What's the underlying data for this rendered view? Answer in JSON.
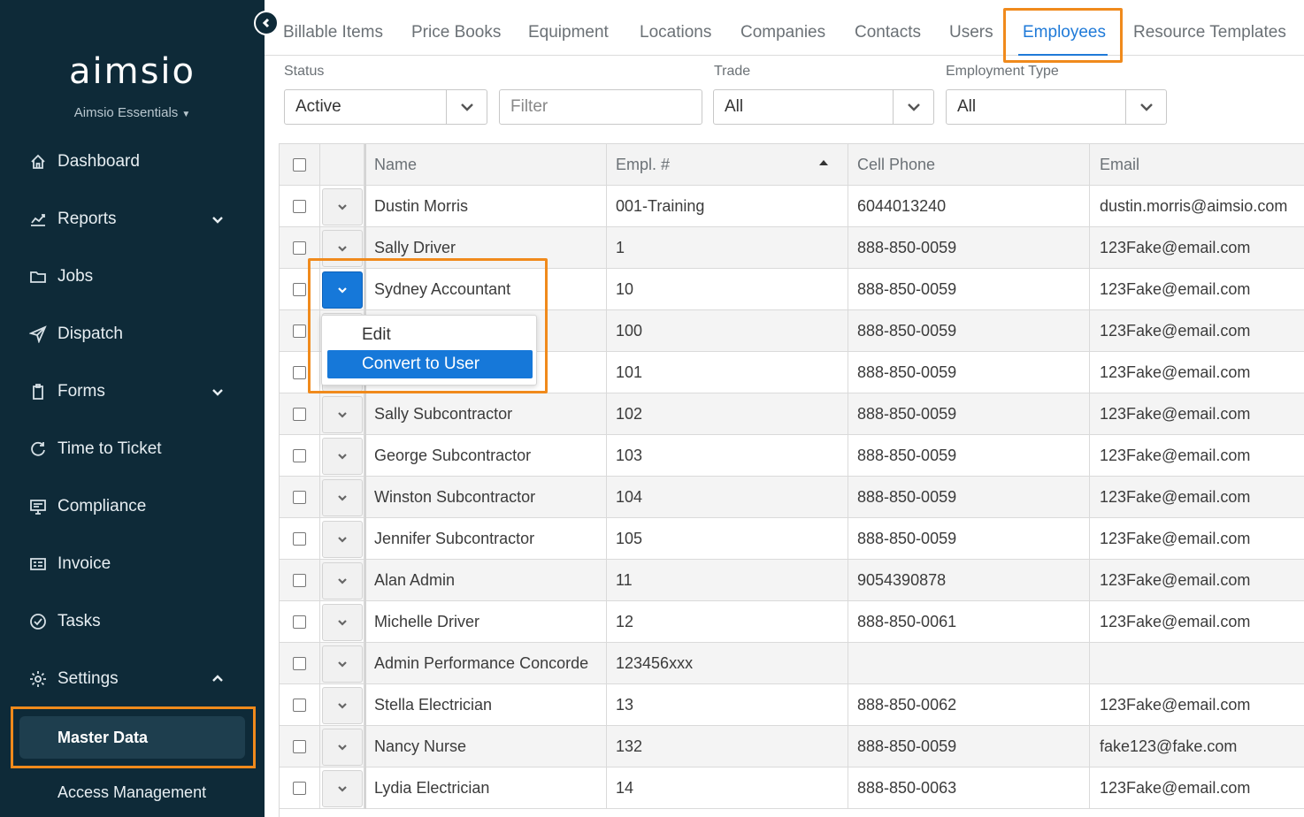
{
  "sidebar": {
    "logo": "aimsio",
    "org": "Aimsio Essentials",
    "items": [
      {
        "label": "Dashboard",
        "icon": "home-icon"
      },
      {
        "label": "Reports",
        "icon": "chart-icon"
      },
      {
        "label": "Jobs",
        "icon": "folder-icon"
      },
      {
        "label": "Dispatch",
        "icon": "send-icon"
      },
      {
        "label": "Forms",
        "icon": "clipboard-icon"
      },
      {
        "label": "Time to Ticket",
        "icon": "refresh-icon"
      },
      {
        "label": "Compliance",
        "icon": "monitor-icon"
      },
      {
        "label": "Invoice",
        "icon": "invoice-icon"
      },
      {
        "label": "Tasks",
        "icon": "check-circle-icon"
      },
      {
        "label": "Settings",
        "icon": "gear-icon"
      }
    ],
    "sub_items": {
      "master_data": "Master Data",
      "access_management": "Access Management"
    }
  },
  "tabs": [
    "Billable Items",
    "Price Books",
    "Equipment",
    "Locations",
    "Companies",
    "Contacts",
    "Users",
    "Employees",
    "Resource Templates"
  ],
  "active_tab": "Employees",
  "filters": {
    "status_label": "Status",
    "status_value": "Active",
    "filter_placeholder": "Filter",
    "trade_label": "Trade",
    "trade_value": "All",
    "employment_type_label": "Employment Type",
    "employment_type_value": "All"
  },
  "table": {
    "columns": [
      "Name",
      "Empl. #",
      "Cell Phone",
      "Email"
    ],
    "sorted_column": "Empl. #",
    "sort_direction": "ascending",
    "rows": [
      {
        "name": "Dustin Morris",
        "empl": "001-Training",
        "phone": "6044013240",
        "email": "dustin.morris@aimsio.com"
      },
      {
        "name": "Sally Driver",
        "empl": "1",
        "phone": "888-850-0059",
        "email": "123Fake@email.com"
      },
      {
        "name": "Sydney Accountant",
        "empl": "10",
        "phone": "888-850-0059",
        "email": "123Fake@email.com"
      },
      {
        "name": "",
        "empl": "100",
        "phone": "888-850-0059",
        "email": "123Fake@email.com"
      },
      {
        "name": "",
        "empl": "101",
        "phone": "888-850-0059",
        "email": "123Fake@email.com"
      },
      {
        "name": "Sally Subcontractor",
        "empl": "102",
        "phone": "888-850-0059",
        "email": "123Fake@email.com"
      },
      {
        "name": "George Subcontractor",
        "empl": "103",
        "phone": "888-850-0059",
        "email": "123Fake@email.com"
      },
      {
        "name": "Winston Subcontractor",
        "empl": "104",
        "phone": "888-850-0059",
        "email": "123Fake@email.com"
      },
      {
        "name": "Jennifer Subcontractor",
        "empl": "105",
        "phone": "888-850-0059",
        "email": "123Fake@email.com"
      },
      {
        "name": "Alan Admin",
        "empl": "11",
        "phone": "9054390878",
        "email": "123Fake@email.com"
      },
      {
        "name": "Michelle Driver",
        "empl": "12",
        "phone": "888-850-0061",
        "email": "123Fake@email.com"
      },
      {
        "name": "Admin Performance Concorde",
        "empl": "123456xxx",
        "phone": "",
        "email": ""
      },
      {
        "name": "Stella Electrician",
        "empl": "13",
        "phone": "888-850-0062",
        "email": "123Fake@email.com"
      },
      {
        "name": "Nancy Nurse",
        "empl": "132",
        "phone": "888-850-0059",
        "email": "fake123@fake.com"
      },
      {
        "name": "Lydia Electrician",
        "empl": "14",
        "phone": "888-850-0063",
        "email": "123Fake@email.com"
      }
    ]
  },
  "row_menu": {
    "edit": "Edit",
    "convert": "Convert to User"
  },
  "colors": {
    "sidebar_bg": "#0e2a38",
    "accent": "#1678d9",
    "highlight": "#f08a1c"
  }
}
